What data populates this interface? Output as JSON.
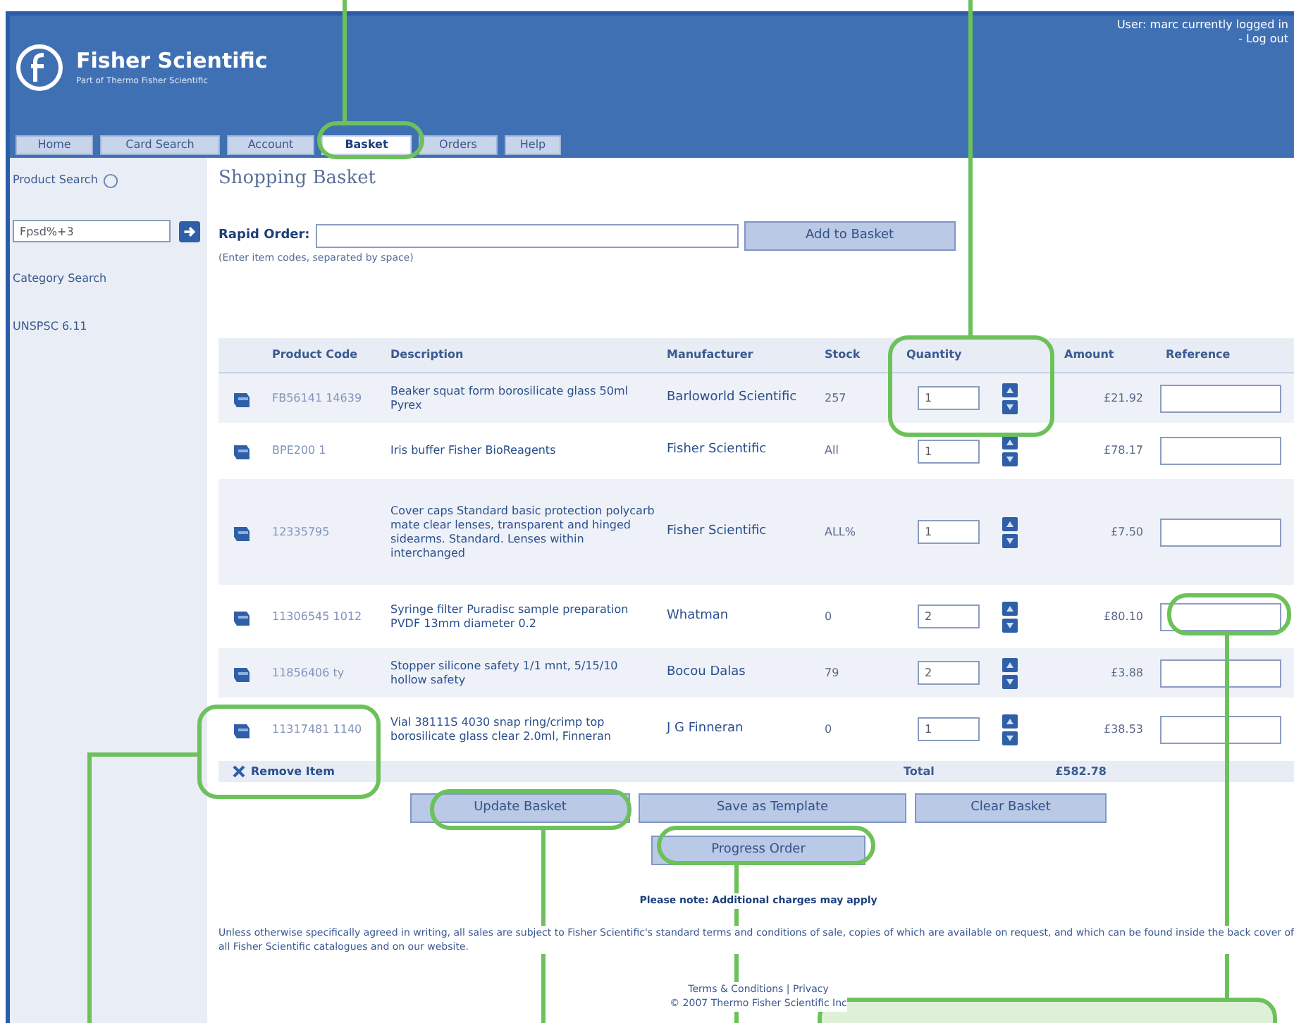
{
  "header": {
    "brand": "Fisher Scientific",
    "tagline": "Part of Thermo Fisher Scientific",
    "user_text": "User: marc currently logged in",
    "logout": "- Log out"
  },
  "tabs": [
    {
      "label": "Home",
      "selected": false
    },
    {
      "label": "Card Search",
      "selected": false
    },
    {
      "label": "Account",
      "selected": false
    },
    {
      "label": "Basket",
      "selected": true
    },
    {
      "label": "Orders",
      "selected": false
    },
    {
      "label": "Help",
      "selected": false
    }
  ],
  "sidebar": {
    "product_search": "Product Search",
    "search_value": "Fpsd%+3",
    "category_search": "Category Search",
    "unspsc": "UNSPSC 6.11"
  },
  "page_title": "Shopping Basket",
  "rapid_order": {
    "label": "Rapid Order:",
    "hint": "(Enter item codes, separated by space)",
    "button": "Add to Basket"
  },
  "table": {
    "columns": [
      "Product Code",
      "Description",
      "Manufacturer",
      "Stock",
      "Quantity",
      "Amount",
      "Reference"
    ],
    "rows": [
      {
        "code": "FB56141 14639",
        "description": "Beaker squat form borosilicate glass 50ml Pyrex",
        "manufacturer": "Barloworld Scientific",
        "stock": "257",
        "quantity": "1",
        "amount": "£21.92"
      },
      {
        "code": "BPE200 1",
        "description": "Iris buffer Fisher BioReagents",
        "manufacturer": "Fisher Scientific",
        "stock": "All",
        "quantity": "1",
        "amount": "£78.17"
      },
      {
        "code": "12335795",
        "description": "Cover caps Standard basic protection polycarb mate clear lenses, transparent and hinged sidearms. Standard. Lenses within interchanged",
        "manufacturer": "Fisher Scientific",
        "stock": "ALL%",
        "quantity": "1",
        "amount": "£7.50"
      },
      {
        "code": "11306545 1012",
        "description": "Syringe filter Puradisc sample preparation PVDF 13mm diameter 0.2",
        "manufacturer": "Whatman",
        "stock": "0",
        "quantity": "2",
        "amount": "£80.10"
      },
      {
        "code": "11856406 ty",
        "description": "Stopper silicone safety 1/1 mnt, 5/15/10 hollow safety",
        "manufacturer": "Bocou Dalas",
        "stock": "79",
        "quantity": "2",
        "amount": "£3.88"
      },
      {
        "code": "11317481 1140",
        "description": "Vial 38111S 4030 snap ring/crimp top borosilicate glass clear 2.0ml, Finneran",
        "manufacturer": "J G Finneran",
        "stock": "0",
        "quantity": "1",
        "amount": "£38.53"
      }
    ],
    "remove": "Remove Item",
    "total_label": "Total",
    "total": "£582.78"
  },
  "buttons": [
    "Update Basket",
    "Save as Template",
    "Clear Basket"
  ],
  "progress_button": "Progress Order",
  "note": "Please note: Additional charges may apply",
  "terms": "Unless otherwise specifically agreed in writing, all sales are subject to Fisher Scientific's standard terms and conditions of sale, copies of which are available on request, and which can be found inside the back cover of all Fisher Scientific catalogues and on our website.",
  "footer": {
    "links": "Terms & Conditions | Privacy",
    "copyright": "© 2007 Thermo Fisher Scientific Inc"
  }
}
